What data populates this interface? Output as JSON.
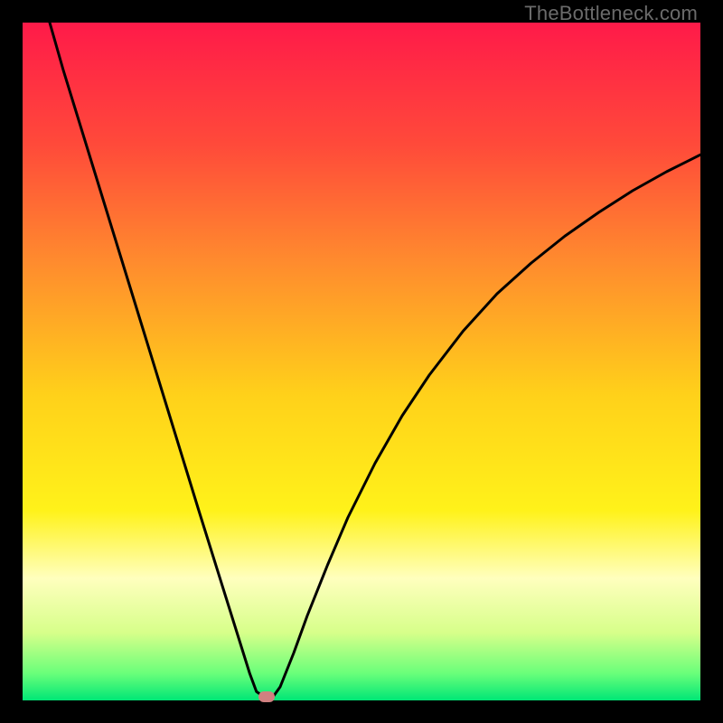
{
  "watermark": "TheBottleneck.com",
  "chart_data": {
    "type": "line",
    "title": "",
    "xlabel": "",
    "ylabel": "",
    "xlim": [
      0,
      100
    ],
    "ylim": [
      0,
      100
    ],
    "series": [
      {
        "name": "bottleneck-curve",
        "x": [
          4,
          6,
          8,
          10,
          12,
          14,
          16,
          18,
          20,
          22,
          24,
          26,
          28,
          30,
          32,
          33.5,
          34.5,
          35.5,
          37,
          38,
          40,
          42,
          45,
          48,
          52,
          56,
          60,
          65,
          70,
          75,
          80,
          85,
          90,
          95,
          100
        ],
        "values": [
          100,
          93,
          86.5,
          80,
          73.5,
          67,
          60.5,
          54,
          47.5,
          41,
          34.5,
          28,
          21.6,
          15.2,
          8.8,
          4,
          1.3,
          0.6,
          0.6,
          2,
          7,
          12.5,
          20,
          27,
          35,
          42,
          48,
          54.5,
          60,
          64.5,
          68.5,
          72,
          75.2,
          78,
          80.5
        ]
      }
    ],
    "marker": {
      "x": 36,
      "y": 0.5
    },
    "gradient_stops": [
      {
        "pct": 0,
        "color": "#ff1a49"
      },
      {
        "pct": 18,
        "color": "#ff4a3a"
      },
      {
        "pct": 35,
        "color": "#ff8a2e"
      },
      {
        "pct": 55,
        "color": "#ffd11a"
      },
      {
        "pct": 72,
        "color": "#fff21a"
      },
      {
        "pct": 82,
        "color": "#ffffbe"
      },
      {
        "pct": 90,
        "color": "#d7ff8a"
      },
      {
        "pct": 96,
        "color": "#6aff7a"
      },
      {
        "pct": 100,
        "color": "#00e676"
      }
    ]
  }
}
